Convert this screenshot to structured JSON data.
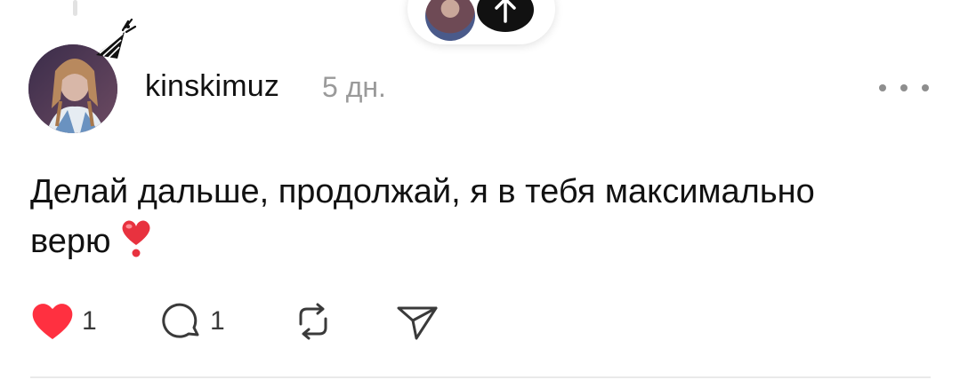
{
  "post": {
    "username": "kinskimuz",
    "timestamp": "5 дн.",
    "text_line1": "Делай дальше, продолжай, я в тебя максимально",
    "text_line2": "верю"
  },
  "actions": {
    "like_count": "1",
    "comment_count": "1"
  },
  "icons": {
    "like": "heart-icon",
    "comment": "comment-bubble-icon",
    "repost": "repost-icon",
    "share": "send-icon",
    "more": "more-dots-icon",
    "scroll_up": "arrow-up-icon",
    "emoji": "red-heart-exclamation-emoji"
  },
  "colors": {
    "like_active": "#ff3040",
    "text": "#111111",
    "muted": "#9a9a9a",
    "icon": "#3a3a3a"
  }
}
